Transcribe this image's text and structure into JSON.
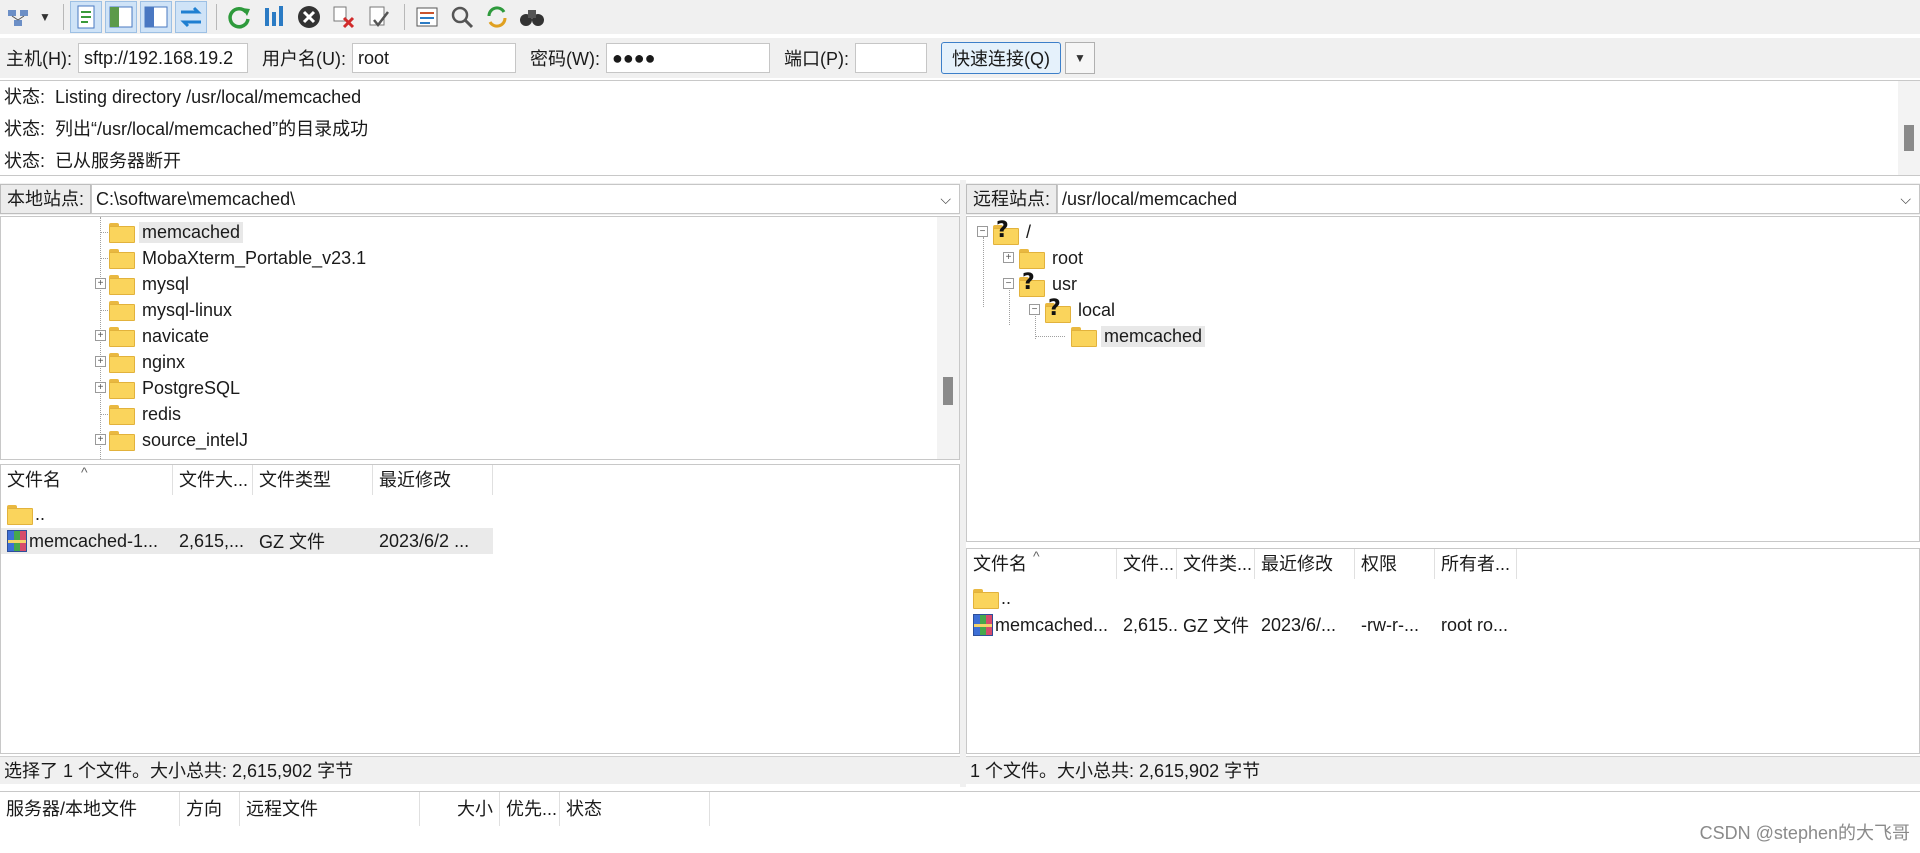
{
  "quickconnect": {
    "host_label": "主机(H):",
    "host_value": "sftp://192.168.19.2",
    "user_label": "用户名(U):",
    "user_value": "root",
    "pass_label": "密码(W):",
    "pass_value": "●●●●",
    "port_label": "端口(P):",
    "port_value": "",
    "connect_label": "快速连接(Q)"
  },
  "log": [
    {
      "label": "状态:",
      "text": "Listing directory /usr/local/memcached"
    },
    {
      "label": "状态:",
      "text": "列出“/usr/local/memcached”的目录成功"
    },
    {
      "label": "状态:",
      "text": "已从服务器断开"
    }
  ],
  "local": {
    "site_label": "本地站点:",
    "path": "C:\\software\\memcached\\",
    "tree": [
      {
        "name": "memcached",
        "expander": false,
        "selected": true
      },
      {
        "name": "MobaXterm_Portable_v23.1",
        "expander": false
      },
      {
        "name": "mysql",
        "expander": true
      },
      {
        "name": "mysql-linux",
        "expander": false
      },
      {
        "name": "navicate",
        "expander": true
      },
      {
        "name": "nginx",
        "expander": true
      },
      {
        "name": "PostgreSQL",
        "expander": true
      },
      {
        "name": "redis",
        "expander": false
      },
      {
        "name": "source_intelJ",
        "expander": true
      }
    ],
    "columns": [
      "文件名",
      "文件大...",
      "文件类型",
      "最近修改"
    ],
    "rows": [
      {
        "name": "..",
        "size": "",
        "type": "",
        "modified": "",
        "kind": "folder"
      },
      {
        "name": "memcached-1...",
        "size": "2,615,...",
        "type": "GZ 文件",
        "modified": "2023/6/2 ...",
        "kind": "archive"
      }
    ],
    "status": "选择了 1 个文件。大小总共: 2,615,902 字节"
  },
  "remote": {
    "site_label": "远程站点:",
    "path": "/usr/local/memcached",
    "tree": {
      "root": "/",
      "root_child": "root",
      "usr": "usr",
      "local": "local",
      "memcached": "memcached"
    },
    "columns": [
      "文件名",
      "文件...",
      "文件类...",
      "最近修改",
      "权限",
      "所有者..."
    ],
    "rows": [
      {
        "name": "..",
        "size": "",
        "type": "",
        "modified": "",
        "perm": "",
        "owner": "",
        "kind": "folder"
      },
      {
        "name": "memcached...",
        "size": "2,615...",
        "type": "GZ 文件",
        "modified": "2023/6/...",
        "perm": "-rw-r-...",
        "owner": "root ro...",
        "kind": "archive"
      }
    ],
    "status": "1 个文件。大小总共: 2,615,902 字节"
  },
  "queue": {
    "columns": [
      "服务器/本地文件",
      "方向",
      "远程文件",
      "大小",
      "优先...",
      "状态"
    ]
  },
  "watermark": "CSDN @stephen的大飞哥",
  "colors": {
    "accent": "#3c7fc9",
    "folder": "#fad45c"
  }
}
